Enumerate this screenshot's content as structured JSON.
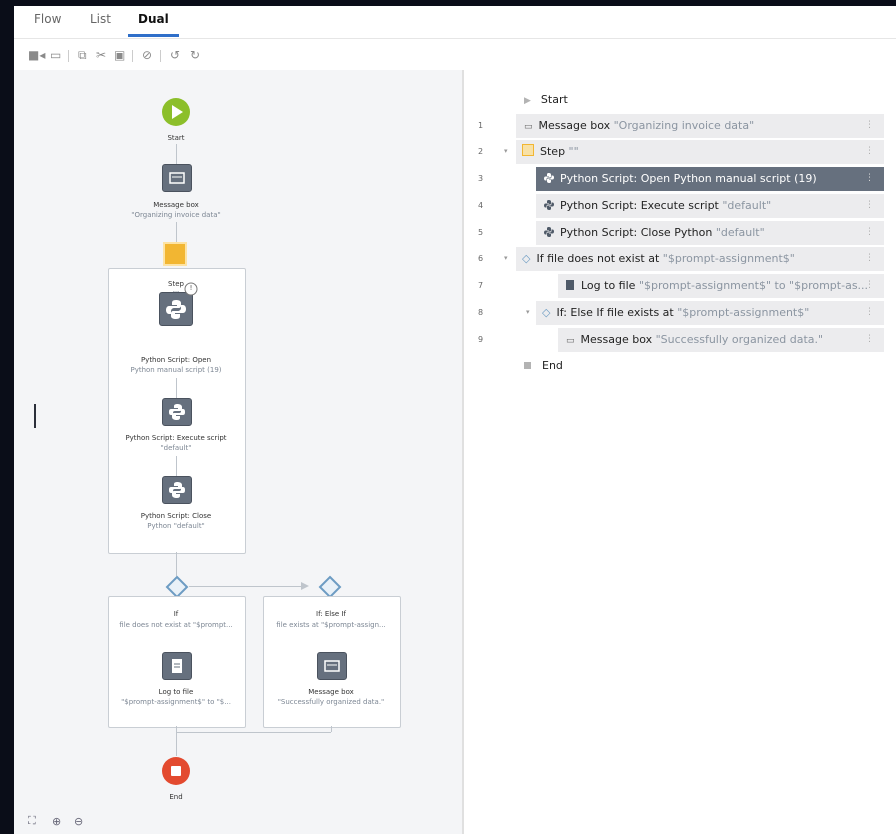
{
  "tabs": [
    {
      "label": "Flow"
    },
    {
      "label": "List"
    },
    {
      "label": "Dual"
    }
  ],
  "toolbar": {
    "icons": [
      "record-icon",
      "window-icon",
      "copy-icon",
      "cut-icon",
      "paste-icon",
      "disable-icon",
      "undo-icon",
      "redo-icon"
    ]
  },
  "flow": {
    "start": "Start",
    "message_title": "Message box",
    "message_sub": "\"Organizing invoice data\"",
    "step_title": "Step",
    "step_sub": "\"\"",
    "py_open_title": "Python Script: Open",
    "py_open_sub": "Python manual script (19)",
    "py_exec_title": "Python Script: Execute script",
    "py_exec_sub": "\"default\"",
    "py_close_title": "Python Script: Close",
    "py_close_sub": "Python \"default\"",
    "if_title": "If",
    "if_sub": "file does not exist at \"$prompt...",
    "elseif_title": "If: Else If",
    "elseif_sub": "file exists at \"$prompt-assign...",
    "log_title": "Log to file",
    "log_sub": "\"$prompt-assignment$\" to \"$...",
    "msg2_title": "Message box",
    "msg2_sub": "\"Successfully organized data.\"",
    "end": "End",
    "badge": "!"
  },
  "list": {
    "start": "Start",
    "end": "End",
    "rows": [
      {
        "num": "1",
        "title": "Message box",
        "sub": "\"Organizing invoice data\""
      },
      {
        "num": "2",
        "title": "Step",
        "sub": "\"\""
      },
      {
        "num": "3",
        "title": "Python Script: Open Python manual script",
        "sub": "(19)"
      },
      {
        "num": "4",
        "title": "Python Script: Execute script",
        "sub": "\"default\""
      },
      {
        "num": "5",
        "title": "Python Script: Close Python",
        "sub": "\"default\""
      },
      {
        "num": "6",
        "title": "If file does not exist at",
        "sub": "\"$prompt-assignment$\""
      },
      {
        "num": "7",
        "title": "Log to file",
        "sub": "\"$prompt-assignment$\" to \"$prompt-as..."
      },
      {
        "num": "8",
        "title": "If: Else If file exists at",
        "sub": "\"$prompt-assignment$\""
      },
      {
        "num": "9",
        "title": "Message box",
        "sub": "\"Successfully organized data.\""
      }
    ]
  },
  "colors": {
    "accent": "#2f6fc9",
    "start": "#8cbf2a",
    "end": "#e34a2f",
    "step": "#f2b632",
    "selected_row": "#66707e"
  }
}
